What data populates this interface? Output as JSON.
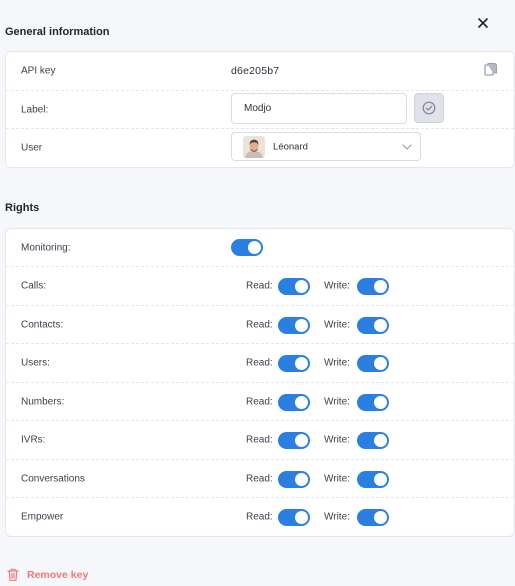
{
  "general": {
    "title": "General information",
    "api_key_label": "API key",
    "api_key_value": "d6e205b7",
    "label_label": "Label:",
    "label_value": "Modjo",
    "user_label": "User",
    "user_name": "Léonard"
  },
  "rights": {
    "title": "Rights",
    "monitoring_label": "Monitoring:",
    "monitoring_enabled": true,
    "read_label": "Read:",
    "write_label": "Write:",
    "items": [
      {
        "label": "Calls:",
        "read": true,
        "write": true
      },
      {
        "label": "Contacts:",
        "read": true,
        "write": true
      },
      {
        "label": "Users:",
        "read": true,
        "write": true
      },
      {
        "label": "Numbers:",
        "read": true,
        "write": true
      },
      {
        "label": "IVRs:",
        "read": true,
        "write": true
      },
      {
        "label": "Conversations",
        "read": true,
        "write": true
      },
      {
        "label": "Empower",
        "read": true,
        "write": true
      }
    ]
  },
  "actions": {
    "remove_label": "Remove key"
  },
  "colors": {
    "accent": "#2a7fe0",
    "danger": "#f07874",
    "background": "#f6f7fa"
  },
  "icons": {
    "close": "close-icon",
    "copy": "copy-icon",
    "confirm": "check-circle-icon",
    "dropdown": "chevron-down-icon",
    "remove": "trash-icon"
  }
}
